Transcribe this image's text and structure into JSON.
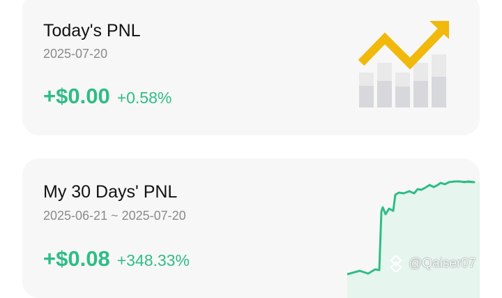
{
  "today_card": {
    "title": "Today's PNL",
    "date": "2025-07-20",
    "amount": "+$0.00",
    "percent": "+0.58%",
    "icon": "bar-chart-up-arrow-icon"
  },
  "thirty_day_card": {
    "title": "My 30 Days' PNL",
    "date_range": "2025-06-21 ~ 2025-07-20",
    "amount": "+$0.08",
    "percent": "+348.33%"
  },
  "watermark": {
    "handle": "@Qaiser07",
    "icon": "binance-square-logo-icon"
  },
  "colors": {
    "positive": "#2ebd85",
    "arrow": "#f0b90b",
    "card_bg": "#f7f7f7"
  }
}
